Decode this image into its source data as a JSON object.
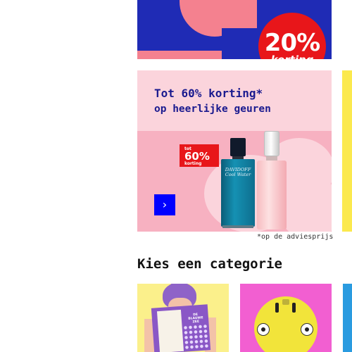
{
  "top_banner": {
    "discount_percent": "20%",
    "discount_word": "korting"
  },
  "promo": {
    "headline": "Tot 60% korting*",
    "subline": "op heerlijke geuren",
    "badge": {
      "line1": "tot",
      "line2": "60%",
      "line3": "korting"
    },
    "bottle_label": "DAVIDOFF Cool Water",
    "arrow_icon": "chevron-right-icon",
    "arrow_glyph": "›",
    "note": "*op de adviesprijs"
  },
  "categories": {
    "heading": "Kies een categorie",
    "tiles": [
      {
        "icon": "books-image",
        "book_title": "DE BLAUWE ZEE"
      },
      {
        "icon": "electronics-image"
      }
    ]
  },
  "colors": {
    "brand_blue": "#0000ff",
    "navy": "#1a1a8f",
    "sale_red": "#e8161a",
    "promo_pink": "#fbd4dc"
  }
}
